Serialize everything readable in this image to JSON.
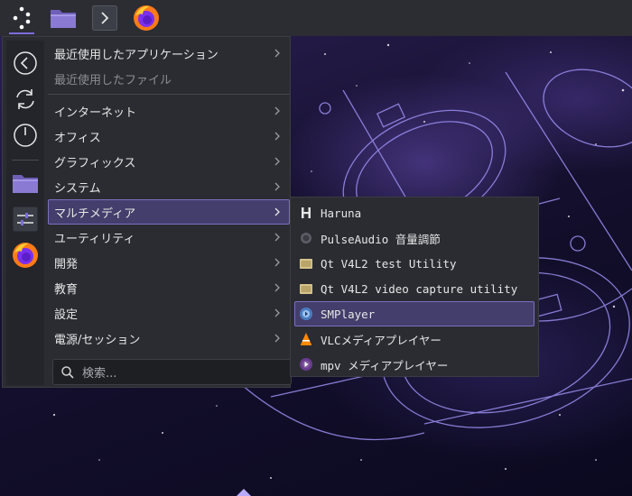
{
  "panel": {
    "items": [
      {
        "name": "application-launcher-icon"
      },
      {
        "name": "folder-icon"
      },
      {
        "name": "terminal-icon"
      },
      {
        "name": "firefox-icon"
      }
    ]
  },
  "favorites": {
    "items": [
      "back-icon",
      "refresh-icon",
      "power-icon",
      "folder-icon",
      "settings-sliders-icon",
      "firefox-icon"
    ]
  },
  "menu": {
    "recent_apps": "最近使用したアプリケーション",
    "recent_files": "最近使用したファイル",
    "categories": [
      {
        "label": "インターネット"
      },
      {
        "label": "オフィス"
      },
      {
        "label": "グラフィックス"
      },
      {
        "label": "システム"
      },
      {
        "label": "マルチメディア",
        "selected": true
      },
      {
        "label": "ユーティリティ"
      },
      {
        "label": "開発"
      },
      {
        "label": "教育"
      },
      {
        "label": "設定"
      },
      {
        "label": "電源/セッション"
      }
    ],
    "search_placeholder": "検索..."
  },
  "submenu": {
    "items": [
      {
        "label": "Haruna",
        "icon": "haruna-icon"
      },
      {
        "label": "PulseAudio 音量調節",
        "icon": "pulseaudio-icon"
      },
      {
        "label": "Qt V4L2 test Utility",
        "icon": "qv4l2-icon"
      },
      {
        "label": "Qt V4L2 video capture utility",
        "icon": "qvidcap-icon"
      },
      {
        "label": "SMPlayer",
        "icon": "smplayer-icon",
        "selected": true
      },
      {
        "label": "VLCメディアプレイヤー",
        "icon": "vlc-icon"
      },
      {
        "label": "mpv メディアプレイヤー",
        "icon": "mpv-icon"
      }
    ]
  },
  "colors": {
    "panel": "#2b2d33",
    "menu_bg": "#2a2c31",
    "highlight": "#433e6b",
    "highlight_border": "#7a70c4"
  }
}
